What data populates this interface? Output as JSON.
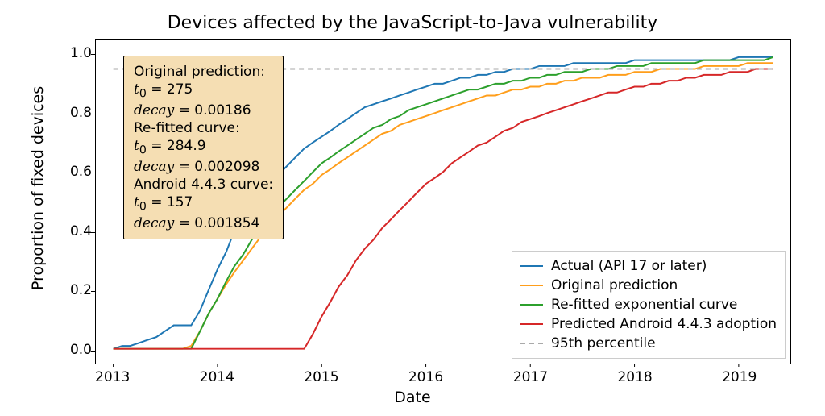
{
  "title": "Devices affected by the JavaScript-to-Java vulnerability",
  "xlabel": "Date",
  "ylabel": "Proportion of fixed devices",
  "annotation": {
    "lines": [
      "Original prediction:",
      "t0_eq_275",
      "decay_eq_000186",
      "Re-fitted curve:",
      "t0_eq_2849",
      "decay_eq_0002098",
      "Android 4.4.3 curve:",
      "t0_eq_157",
      "decay_eq_0001854"
    ],
    "text": {
      "t0_eq_275": [
        "t",
        "0",
        " = 275"
      ],
      "decay_eq_000186": [
        "decay",
        " = 0.00186"
      ],
      "t0_eq_2849": [
        "t",
        "0",
        " = 284.9"
      ],
      "decay_eq_0002098": [
        "decay",
        " = 0.002098"
      ],
      "t0_eq_157": [
        "t",
        "0",
        " = 157"
      ],
      "decay_eq_0001854": [
        "decay",
        " = 0.001854"
      ]
    }
  },
  "legend": [
    {
      "label": "Actual (API 17 or later)",
      "color": "#1f77b4",
      "dashed": false
    },
    {
      "label": "Original prediction",
      "color": "#ff9e1b",
      "dashed": false
    },
    {
      "label": "Re-fitted exponential curve",
      "color": "#2ca02c",
      "dashed": false
    },
    {
      "label": "Predicted Android 4.4.3 adoption",
      "color": "#d62728",
      "dashed": false
    },
    {
      "label": "95th percentile",
      "color": "#aaaaaa",
      "dashed": true
    }
  ],
  "xticks": [
    "2013",
    "2014",
    "2015",
    "2016",
    "2017",
    "2018",
    "2019"
  ],
  "yticks": [
    "0.0",
    "0.2",
    "0.4",
    "0.6",
    "0.8",
    "1.0"
  ],
  "chart_data": {
    "type": "line",
    "xlabel": "Date",
    "ylabel": "Proportion of fixed devices",
    "title": "Devices affected by the JavaScript-to-Java vulnerability",
    "xlim": [
      "2012-11",
      "2019-07"
    ],
    "ylim": [
      -0.05,
      1.05
    ],
    "x": [
      "2013-01",
      "2013-02",
      "2013-03",
      "2013-04",
      "2013-05",
      "2013-06",
      "2013-07",
      "2013-08",
      "2013-09",
      "2013-10",
      "2013-11",
      "2013-12",
      "2014-01",
      "2014-02",
      "2014-03",
      "2014-04",
      "2014-05",
      "2014-06",
      "2014-07",
      "2014-08",
      "2014-09",
      "2014-10",
      "2014-11",
      "2014-12",
      "2015-01",
      "2015-02",
      "2015-03",
      "2015-04",
      "2015-05",
      "2015-06",
      "2015-07",
      "2015-08",
      "2015-09",
      "2015-10",
      "2015-11",
      "2015-12",
      "2016-01",
      "2016-02",
      "2016-03",
      "2016-04",
      "2016-05",
      "2016-06",
      "2016-07",
      "2016-08",
      "2016-09",
      "2016-10",
      "2016-11",
      "2016-12",
      "2017-01",
      "2017-02",
      "2017-03",
      "2017-04",
      "2017-05",
      "2017-06",
      "2017-07",
      "2017-08",
      "2017-09",
      "2017-10",
      "2017-11",
      "2017-12",
      "2018-01",
      "2018-02",
      "2018-03",
      "2018-04",
      "2018-05",
      "2018-06",
      "2018-07",
      "2018-08",
      "2018-09",
      "2018-10",
      "2018-11",
      "2018-12",
      "2019-01",
      "2019-02",
      "2019-03",
      "2019-04",
      "2019-05"
    ],
    "series": [
      {
        "name": "Actual (API 17 or later)",
        "color": "#1f77b4",
        "values": [
          0.0,
          0.01,
          0.01,
          0.02,
          0.03,
          0.04,
          0.06,
          0.08,
          0.08,
          0.08,
          0.13,
          0.2,
          0.27,
          0.33,
          0.4,
          0.44,
          0.48,
          0.5,
          0.54,
          0.59,
          0.62,
          0.65,
          0.68,
          0.7,
          0.72,
          0.74,
          0.76,
          0.78,
          0.8,
          0.82,
          0.83,
          0.84,
          0.85,
          0.86,
          0.87,
          0.88,
          0.89,
          0.9,
          0.9,
          0.91,
          0.92,
          0.92,
          0.93,
          0.93,
          0.94,
          0.94,
          0.95,
          0.95,
          0.95,
          0.96,
          0.96,
          0.96,
          0.96,
          0.97,
          0.97,
          0.97,
          0.97,
          0.97,
          0.97,
          0.97,
          0.98,
          0.98,
          0.98,
          0.98,
          0.98,
          0.98,
          0.98,
          0.98,
          0.98,
          0.98,
          0.98,
          0.98,
          0.99,
          0.99,
          0.99,
          0.99,
          0.99
        ]
      },
      {
        "name": "Original prediction",
        "color": "#ff9e1b",
        "values": [
          0.0,
          0.0,
          0.0,
          0.0,
          0.0,
          0.0,
          0.0,
          0.0,
          0.0,
          0.01,
          0.06,
          0.12,
          0.17,
          0.22,
          0.26,
          0.3,
          0.34,
          0.38,
          0.41,
          0.45,
          0.48,
          0.51,
          0.54,
          0.56,
          0.59,
          0.61,
          0.63,
          0.65,
          0.67,
          0.69,
          0.71,
          0.73,
          0.74,
          0.76,
          0.77,
          0.78,
          0.79,
          0.8,
          0.81,
          0.82,
          0.83,
          0.84,
          0.85,
          0.86,
          0.86,
          0.87,
          0.88,
          0.88,
          0.89,
          0.89,
          0.9,
          0.9,
          0.91,
          0.91,
          0.92,
          0.92,
          0.92,
          0.93,
          0.93,
          0.93,
          0.94,
          0.94,
          0.94,
          0.95,
          0.95,
          0.95,
          0.95,
          0.95,
          0.96,
          0.96,
          0.96,
          0.96,
          0.96,
          0.97,
          0.97,
          0.97,
          0.97
        ]
      },
      {
        "name": "Re-fitted exponential curve",
        "color": "#2ca02c",
        "values": [
          0.0,
          0.0,
          0.0,
          0.0,
          0.0,
          0.0,
          0.0,
          0.0,
          0.0,
          0.0,
          0.06,
          0.12,
          0.17,
          0.23,
          0.28,
          0.32,
          0.37,
          0.41,
          0.44,
          0.48,
          0.51,
          0.54,
          0.57,
          0.6,
          0.63,
          0.65,
          0.67,
          0.69,
          0.71,
          0.73,
          0.75,
          0.76,
          0.78,
          0.79,
          0.81,
          0.82,
          0.83,
          0.84,
          0.85,
          0.86,
          0.87,
          0.88,
          0.88,
          0.89,
          0.9,
          0.9,
          0.91,
          0.91,
          0.92,
          0.92,
          0.93,
          0.93,
          0.94,
          0.94,
          0.94,
          0.95,
          0.95,
          0.95,
          0.96,
          0.96,
          0.96,
          0.96,
          0.97,
          0.97,
          0.97,
          0.97,
          0.97,
          0.97,
          0.98,
          0.98,
          0.98,
          0.98,
          0.98,
          0.98,
          0.98,
          0.98,
          0.99
        ]
      },
      {
        "name": "Predicted Android 4.4.3 adoption",
        "color": "#d62728",
        "values": [
          0.0,
          0.0,
          0.0,
          0.0,
          0.0,
          0.0,
          0.0,
          0.0,
          0.0,
          0.0,
          0.0,
          0.0,
          0.0,
          0.0,
          0.0,
          0.0,
          0.0,
          0.0,
          0.0,
          0.0,
          0.0,
          0.0,
          0.0,
          0.05,
          0.11,
          0.16,
          0.21,
          0.25,
          0.3,
          0.34,
          0.37,
          0.41,
          0.44,
          0.47,
          0.5,
          0.53,
          0.56,
          0.58,
          0.6,
          0.63,
          0.65,
          0.67,
          0.69,
          0.7,
          0.72,
          0.74,
          0.75,
          0.77,
          0.78,
          0.79,
          0.8,
          0.81,
          0.82,
          0.83,
          0.84,
          0.85,
          0.86,
          0.87,
          0.87,
          0.88,
          0.89,
          0.89,
          0.9,
          0.9,
          0.91,
          0.91,
          0.92,
          0.92,
          0.93,
          0.93,
          0.93,
          0.94,
          0.94,
          0.94,
          0.95,
          0.95,
          0.95
        ]
      },
      {
        "name": "95th percentile",
        "color": "#aaaaaa",
        "dashed": true,
        "values": [
          0.95,
          0.95,
          0.95,
          0.95,
          0.95,
          0.95,
          0.95,
          0.95,
          0.95,
          0.95,
          0.95,
          0.95,
          0.95,
          0.95,
          0.95,
          0.95,
          0.95,
          0.95,
          0.95,
          0.95,
          0.95,
          0.95,
          0.95,
          0.95,
          0.95,
          0.95,
          0.95,
          0.95,
          0.95,
          0.95,
          0.95,
          0.95,
          0.95,
          0.95,
          0.95,
          0.95,
          0.95,
          0.95,
          0.95,
          0.95,
          0.95,
          0.95,
          0.95,
          0.95,
          0.95,
          0.95,
          0.95,
          0.95,
          0.95,
          0.95,
          0.95,
          0.95,
          0.95,
          0.95,
          0.95,
          0.95,
          0.95,
          0.95,
          0.95,
          0.95,
          0.95,
          0.95,
          0.95,
          0.95,
          0.95,
          0.95,
          0.95,
          0.95,
          0.95,
          0.95,
          0.95,
          0.95,
          0.95,
          0.95,
          0.95,
          0.95,
          0.95
        ]
      }
    ]
  }
}
